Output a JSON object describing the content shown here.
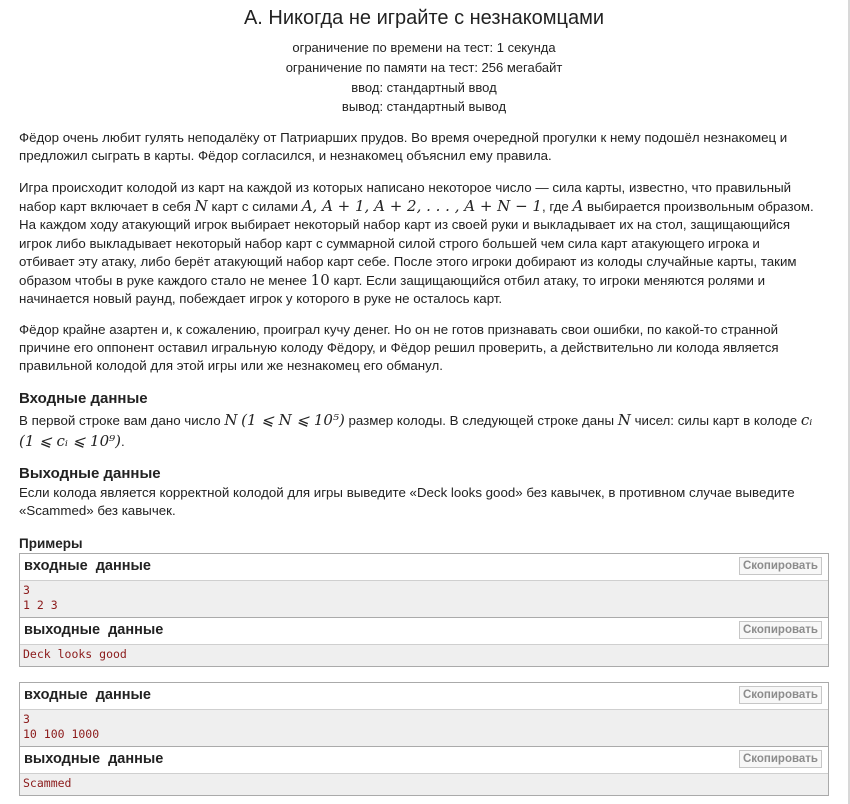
{
  "problem": {
    "title": "A. Никогда не играйте с незнакомцами",
    "time_limit": "ограничение по времени на тест: 1 секунда",
    "memory_limit": "ограничение по памяти на тест: 256 мегабайт",
    "input": "ввод: стандартный ввод",
    "output": "вывод: стандартный вывод"
  },
  "statement": {
    "p1": "Фёдор очень любит гулять неподалёку от Патриарших прудов. Во время очередной прогулки к нему подошёл незнакомец и предложил сыграть в карты. Фёдор согласился, и незнакомец объяснил ему правила.",
    "p2_a": "Игра происходит колодой из карт на каждой из которых написано некоторое число — сила карты, известно, что правильный набор карт включает в себя ",
    "p2_m1": "N",
    "p2_b": " карт с силами ",
    "p2_m2": "A, A + 1, A + 2, . . . , A + N − 1",
    "p2_c": ", где ",
    "p2_m3": "A",
    "p2_d": " выбирается произвольным образом. На каждом ходу атакующий игрок выбирает некоторый набор карт из своей руки и выкладывает их на стол, защищающийся игрок либо выкладывает некоторый набор карт с суммарной силой строго большей чем сила карт атакующего игрока и отбивает эту атаку, либо берёт атакующий набор карт себе. После этого игроки добирают из колоды случайные карты, таким образом чтобы в руке каждого стало не менее ",
    "p2_m4": "10",
    "p2_e": " карт. Если защищающийся отбил атаку, то игроки меняются ролями и начинается новый раунд, побеждает игрок у которого в руке не осталось карт.",
    "p3": "Фёдор крайне азартен и, к сожалению, проиграл кучу денег. Но он не готов признавать свои ошибки, по какой-то странной причине его оппонент оставил игральную колоду Фёдору, и Фёдор решил проверить, а действительно ли колода является правильной колодой для этой игры или же незнакомец его обманул."
  },
  "input_section": {
    "heading": "Входные данные",
    "text_a": "В первой строке вам дано число ",
    "m1": "N",
    "m2": "(1 ⩽ N ⩽ 10⁵)",
    "text_b": " размер колоды. В следующей строке даны ",
    "m3": "N",
    "text_c": " чисел: силы карт в колоде ",
    "m4": "cᵢ",
    "m5": "(1 ⩽ cᵢ ⩽ 10⁹)",
    "text_d": "."
  },
  "output_section": {
    "heading": "Выходные данные",
    "text": "Если колода является корректной колодой для игры выведите «Deck looks good» без кавычек, в противном случае выведите «Scammed» без кавычек."
  },
  "examples": {
    "heading": "Примеры",
    "input_label": "входные данные",
    "output_label": "выходные данные",
    "copy_label": "Скопировать",
    "tests": [
      {
        "input": "3\n1 2 3",
        "output": "Deck looks good"
      },
      {
        "input": "3\n10 100 1000",
        "output": "Scammed"
      }
    ]
  }
}
